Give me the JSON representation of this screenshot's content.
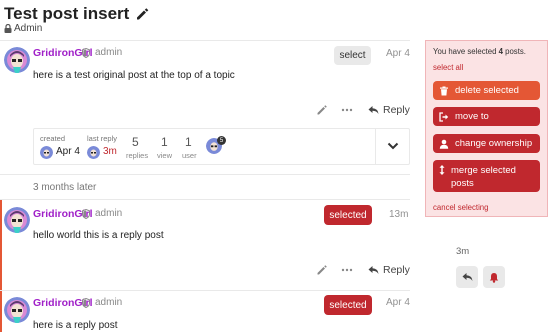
{
  "topic": {
    "title": "Test post insert",
    "category": "Admin"
  },
  "posts": [
    {
      "username": "GridironGirl",
      "role": "admin",
      "date": "Apr 4",
      "body": "here is a test original post at the top of a topic",
      "select_label": "select",
      "reply_label": "Reply"
    },
    {
      "username": "GridironGirl",
      "role": "admin",
      "date": "13m",
      "body": "hello world this is a reply post",
      "select_label": "selected",
      "reply_label": "Reply"
    },
    {
      "username": "GridironGirl",
      "role": "admin",
      "date": "Apr 4",
      "body": "here is a reply post",
      "select_label": "selected"
    }
  ],
  "topic_map": {
    "created_label": "created",
    "created_value": "Apr 4",
    "last_reply_label": "last reply",
    "last_reply_value": "3m",
    "replies_count": "5",
    "replies_label": "replies",
    "views_count": "1",
    "views_label": "view",
    "users_count": "1",
    "users_label": "user",
    "user_badge": "5"
  },
  "small_action": "3 months later",
  "multi_select": {
    "info_prefix": "You have selected ",
    "info_count": "4",
    "info_suffix": " posts.",
    "select_all": "select all",
    "delete": "delete selected",
    "move": "move to",
    "ownership": "change ownership",
    "merge": "merge selected posts",
    "cancel": "cancel selecting"
  },
  "timeline": {
    "ago": "3m"
  },
  "colors": {
    "accent": "#c0282e",
    "danger": "#e45735",
    "username": "#a020c8",
    "panel_bg": "#fbe3e4"
  }
}
